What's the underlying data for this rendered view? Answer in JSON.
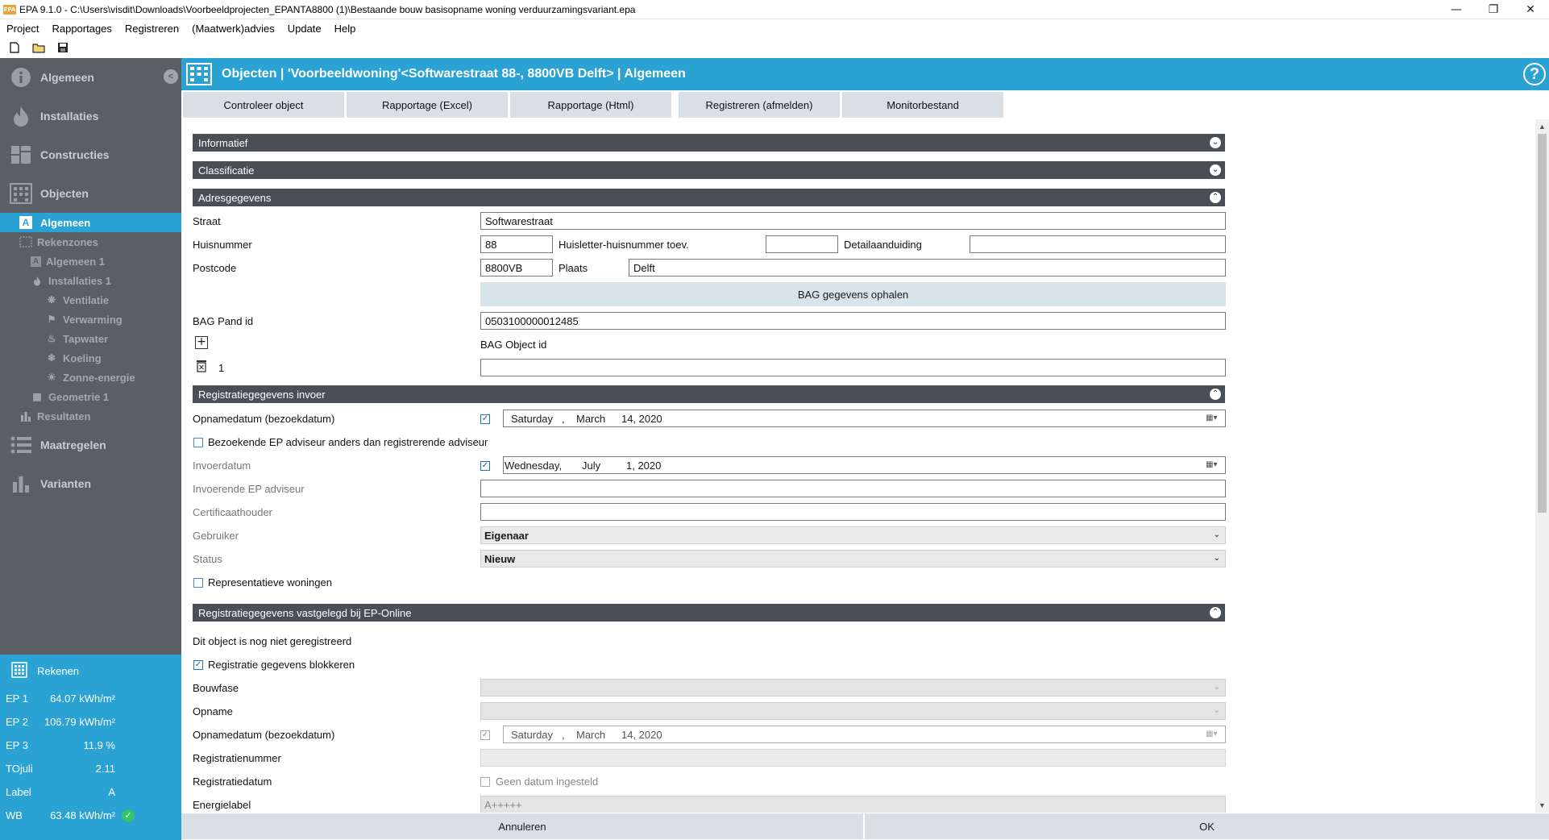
{
  "window": {
    "title": "EPA 9.1.0 - C:\\Users\\visdit\\Downloads\\Voorbeeldprojecten_EPANTA8800 (1)\\Bestaande bouw basisopname woning verduurzamingsvariant.epa",
    "app_badge": "EPA"
  },
  "menu": [
    "Project",
    "Rapportages",
    "Registreren",
    "(Maatwerk)advies",
    "Update",
    "Help"
  ],
  "sidebar": {
    "main_items": [
      "Algemeen",
      "Installaties",
      "Constructies",
      "Objecten",
      "Maatregelen",
      "Varianten"
    ],
    "object_tree": [
      "Algemeen",
      "Rekenzones",
      "Algemeen 1",
      "Installaties 1",
      "Ventilatie",
      "Verwarming",
      "Tapwater",
      "Koeling",
      "Zonne-energie",
      "Geometrie 1",
      "Resultaten"
    ],
    "active_item": "Algemeen"
  },
  "results": {
    "title": "Rekenen",
    "rows": [
      {
        "label": "EP 1",
        "value": "64.07 kWh/m²"
      },
      {
        "label": "EP 2",
        "value": "106.79 kWh/m²"
      },
      {
        "label": "EP 3",
        "value": "11.9 %"
      },
      {
        "label": "TOjuli",
        "value": "2.11"
      },
      {
        "label": "Label",
        "value": "A"
      },
      {
        "label": "WB",
        "value": "63.48 kWh/m²"
      }
    ]
  },
  "header": {
    "title": "Objecten | 'Voorbeeldwoning'<Softwarestraat 88-, 8800VB Delft> | Algemeen",
    "help": "?"
  },
  "actions": [
    "Controleer object",
    "Rapportage (Excel)",
    "Rapportage (Html)",
    "Registreren (afmelden)",
    "Monitorbestand"
  ],
  "sections": {
    "informatief": "Informatief",
    "classificatie": "Classificatie",
    "adres": "Adresgegevens",
    "registratie_invoer": "Registratiegegevens invoer",
    "registratie_ep": "Registratiegegevens vastgelegd bij EP-Online"
  },
  "address": {
    "straat_label": "Straat",
    "straat": "Softwarestraat",
    "huisnummer_label": "Huisnummer",
    "huisnummer": "88",
    "toev_label": "Huisletter-huisnummer toev.",
    "toev": "",
    "detail_label": "Detailaanduiding",
    "detail": "",
    "postcode_label": "Postcode",
    "postcode": "8800VB",
    "plaats_label": "Plaats",
    "plaats": "Delft",
    "bag_button": "BAG gegevens ophalen",
    "bag_pand_label": "BAG Pand id",
    "bag_pand": "0503100000012485",
    "bag_object_label": "BAG Object id",
    "bag_object_index": "1",
    "bag_object": ""
  },
  "registration": {
    "opnamedatum_label": "Opnamedatum (bezoekdatum)",
    "opnamedatum": {
      "day": "Saturday",
      "sep": ",",
      "month": "March",
      "date": "14, 2020"
    },
    "bezoekende_label": "Bezoekende EP adviseur anders dan registrerende adviseur",
    "invoerdatum_label": "Invoerdatum",
    "invoerdatum": {
      "day": "Wednesday,",
      "month": "July",
      "date": "1, 2020"
    },
    "invoerende_label": "Invoerende  EP adviseur",
    "certificaathouder_label": "Certificaathouder",
    "gebruiker_label": "Gebruiker",
    "gebruiker": "Eigenaar",
    "status_label": "Status",
    "status": "Nieuw",
    "representatief_label": "Representatieve woningen"
  },
  "ep_online": {
    "notice": "Dit object is nog niet geregistreerd",
    "blokkeren_label": "Registratie gegevens blokkeren",
    "bouwfase_label": "Bouwfase",
    "opname_label": "Opname",
    "opnamedatum_label": "Opnamedatum (bezoekdatum)",
    "opnamedatum": {
      "day": "Saturday",
      "sep": ",",
      "month": "March",
      "date": "14, 2020"
    },
    "registratienummer_label": "Registratienummer",
    "registratiedatum_label": "Registratiedatum",
    "geen_datum_label": "Geen datum ingesteld",
    "energielabel_label": "Energielabel",
    "energielabel": "A+++++"
  },
  "footer": {
    "cancel": "Annuleren",
    "ok": "OK"
  },
  "colors": {
    "accent": "#2aa3d4",
    "sidebar": "#5a5f66",
    "section": "#4a4f55"
  }
}
